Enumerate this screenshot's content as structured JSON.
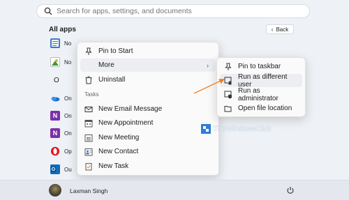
{
  "search": {
    "placeholder": "Search for apps, settings, and documents"
  },
  "start": {
    "all_apps": "All apps",
    "back": "Back"
  },
  "apps": [
    {
      "label": "No",
      "icon": "notepad-icon"
    },
    {
      "label": "No",
      "icon": "photo-app-icon"
    },
    {
      "label": "O",
      "icon": ""
    },
    {
      "label": "On",
      "icon": "onedrive-icon"
    },
    {
      "label": "On",
      "icon": "onenote-icon"
    },
    {
      "label": "On",
      "icon": "onenote-icon"
    },
    {
      "label": "Op",
      "icon": "opera-icon"
    },
    {
      "label": "Ou",
      "icon": "outlook-icon"
    }
  ],
  "context_menu": {
    "items": [
      {
        "label": "Pin to Start",
        "icon": "pin-icon"
      },
      {
        "label": "More",
        "icon": ""
      },
      {
        "label": "Uninstall",
        "icon": "trash-icon"
      }
    ],
    "tasks_label": "Tasks",
    "tasks": [
      {
        "label": "New Email Message",
        "icon": "email-icon"
      },
      {
        "label": "New Appointment",
        "icon": "calendar-icon"
      },
      {
        "label": "New Meeting",
        "icon": "meeting-icon"
      },
      {
        "label": "New Contact",
        "icon": "contact-icon"
      },
      {
        "label": "New Task",
        "icon": "task-icon"
      }
    ]
  },
  "submenu": {
    "items": [
      {
        "label": "Pin to taskbar",
        "icon": "pin-icon"
      },
      {
        "label": "Run as different user",
        "icon": "run-as-user-icon"
      },
      {
        "label": "Run as administrator",
        "icon": "shield-icon"
      },
      {
        "label": "Open file location",
        "icon": "folder-icon"
      }
    ]
  },
  "watermark": "TheWindowsClub",
  "user": {
    "name": "Laxman Singh"
  },
  "colors": {
    "accent": "#f47c20",
    "background": "#eef1f6",
    "watermark_logo": "#2f7dd6"
  }
}
